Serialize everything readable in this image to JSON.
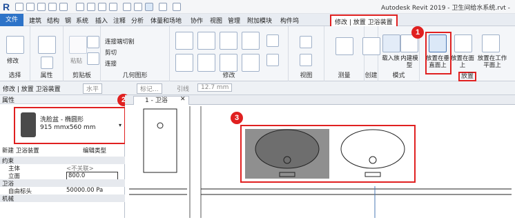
{
  "app": {
    "title": "Autodesk Revit 2019 - 卫生间给水系统.rvt -"
  },
  "menu": {
    "file": "文件",
    "items": [
      "建筑",
      "结构",
      "钢",
      "系统",
      "插入",
      "注释",
      "分析",
      "体量和场地",
      "协作",
      "视图",
      "管理",
      "附加模块",
      "构件坞"
    ],
    "context_tab": "修改 | 放置 卫浴装置"
  },
  "ribbon": {
    "select": {
      "label": "选择",
      "tool": "修改"
    },
    "properties": {
      "label": "属性"
    },
    "clipboard": {
      "label": "剪贴板",
      "paste": "粘贴"
    },
    "geometry": {
      "label": "几何图形",
      "items": [
        "连接端切割",
        "剪切",
        "连接"
      ]
    },
    "modify": {
      "label": "修改"
    },
    "view": {
      "label": "视图"
    },
    "measure": {
      "label": "测量"
    },
    "create": {
      "label": "创建"
    },
    "mode": {
      "label": "模式",
      "load": "载入族",
      "inplace": "内建模型"
    },
    "placement": {
      "label": "放置",
      "vertical": "放置在垂直面上",
      "face": "放置在面上",
      "workplane": "放置在工作平面上"
    }
  },
  "options": {
    "context": "修改 | 放置 卫浴装置",
    "orient": "水平",
    "tag": "标记...",
    "leader": "引线",
    "length": "12.7 mm"
  },
  "properties": {
    "header": "属性",
    "type_name": "洗脸盆 - 椭圆形",
    "type_size": "915 mmx560 mm",
    "new_label": "新建 卫浴装置",
    "edit_type": "编辑类型",
    "constraints": "约束",
    "host": "主体",
    "host_value": "<不关联>",
    "elevation": "立面",
    "elevation_value": "800.0",
    "plumbing": "卫浴",
    "fixture": "自由标头",
    "fixture_value": "50000.00 Pa",
    "mechanical": "机械"
  },
  "view": {
    "tab": "1 - 卫浴"
  },
  "badges": [
    "1",
    "2",
    "3"
  ],
  "colors": {
    "accent": "#2d73c8",
    "highlight": "#e02020"
  }
}
